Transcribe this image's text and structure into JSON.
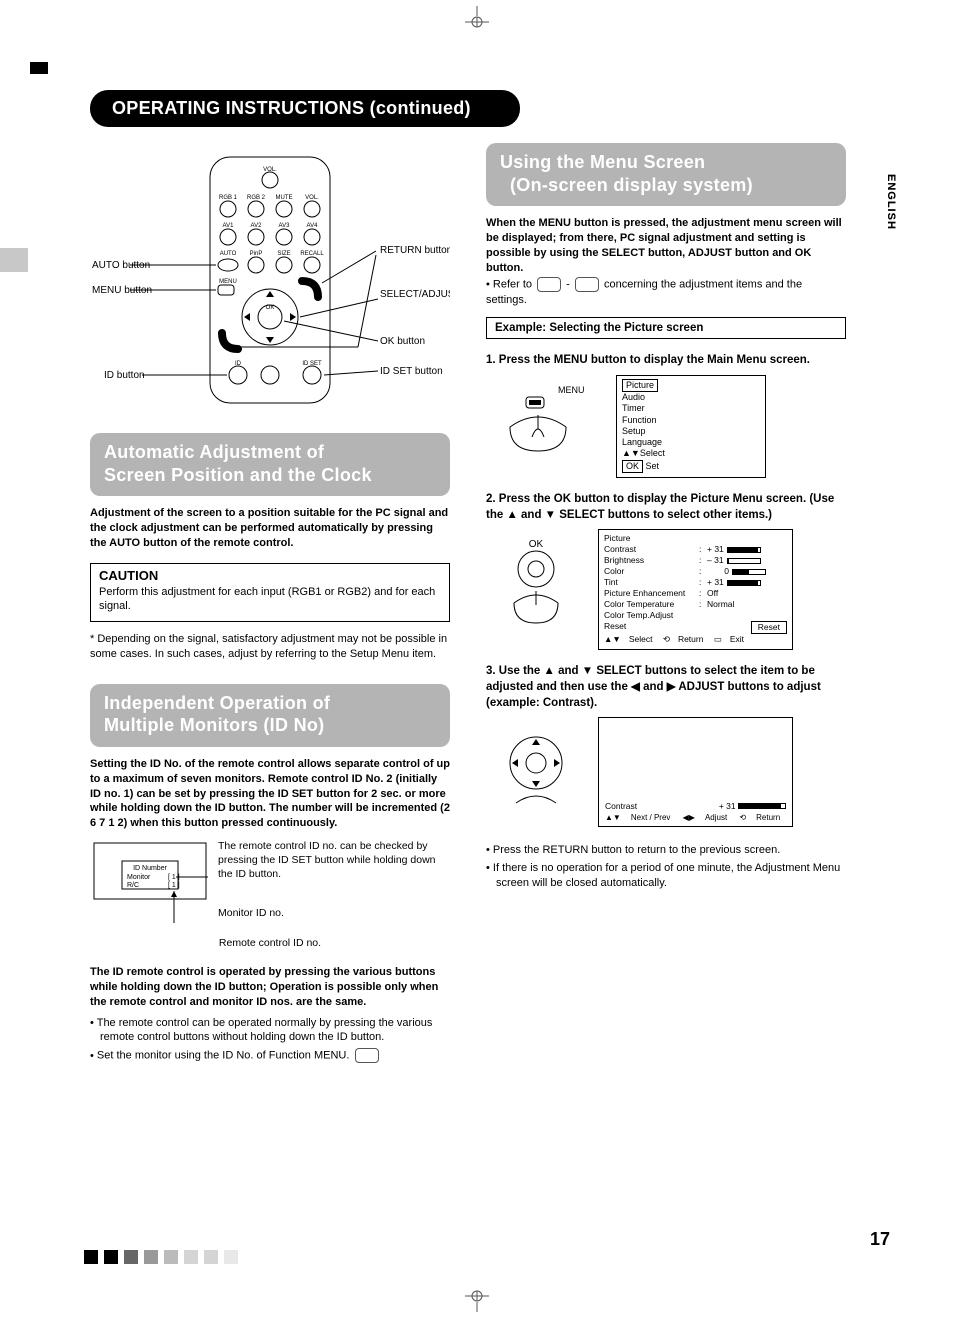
{
  "lang_tab": "ENGLISH",
  "page_number": "17",
  "header": "OPERATING INSTRUCTIONS (continued)",
  "remote_labels": {
    "auto": "AUTO button",
    "menu": "MENU button",
    "id": "ID button",
    "return": "RETURN buttons",
    "select_adjust": "SELECT/ADJUST buttons",
    "ok": "OK button",
    "idset": "ID SET button"
  },
  "remote_small": {
    "vol_minus": "VOL.",
    "rgb1": "RGB 1",
    "rgb2": "RGB 2",
    "mute": "MUTE",
    "vol": "VOL.",
    "av1": "AV1",
    "av2": "AV2",
    "av3": "AV3",
    "av4": "AV4",
    "auto": "AUTO",
    "pinp": "PinP",
    "size": "SIZE",
    "recall": "RECALL",
    "menu": "MENU",
    "ok": "OK",
    "id": "ID",
    "idset": "ID SET"
  },
  "sec1": {
    "title_l1": "Automatic Adjustment of",
    "title_l2": "Screen Position and the Clock",
    "body": "Adjustment of the screen to a position suitable for the PC signal and the clock adjustment can be performed automatically by pressing the AUTO button of the remote control.",
    "caution_h": "CAUTION",
    "caution_b": "Perform this adjustment for each input (RGB1 or RGB2) and for each signal.",
    "note": "* Depending on the signal, satisfactory adjustment may not be possible in some cases. In such cases, adjust by referring to the Setup Menu item."
  },
  "sec2": {
    "title_l1": "Independent Operation of",
    "title_l2": "Multiple Monitors (ID No)",
    "body": "Setting the ID No. of the remote control allows separate control of up to a maximum of seven monitors. Remote control ID No. 2 (initially ID no. 1) can be set by pressing the ID SET button for 2 sec. or more while holding down the ID button.  The number will be incremented (2   6   7   1   2) when this button pressed continuously.",
    "id_text": "The remote control ID no. can be checked by pressing the ID SET button while holding down the ID button.",
    "id_box_title": "ID Number",
    "id_box_monitor": "Monitor",
    "id_box_rc": "R/C",
    "id_box_val1": "[ 1 ]",
    "id_box_val2": "[ 1 ]",
    "monitor_id": "Monitor ID no.",
    "remote_id": "Remote control ID no.",
    "body2": "The ID remote control is operated by pressing the various buttons while holding down the ID button; Operation is possible only when the remote control and monitor ID nos. are the same.",
    "b1": "The remote control can be operated normally by pressing the various remote control buttons without holding down the ID button.",
    "b2": "Set the monitor using the ID No. of Function MENU."
  },
  "sec3": {
    "title_l1": "Using the Menu Screen",
    "title_l2": "(On-screen display system)",
    "intro": "When the MENU button is pressed, the adjustment menu screen will be displayed; from there, PC signal adjustment and setting is possible by using the SELECT button, ADJUST button and OK button.",
    "refer": "Refer to",
    "refer_tail": "concerning the adjustment items and the settings.",
    "example": "Example: Selecting the Picture screen",
    "step1": "1. Press the MENU button to display the Main Menu screen.",
    "menu_label": "MENU",
    "main_menu": {
      "items": [
        "Picture",
        "Audio",
        "Timer",
        "Function",
        "Setup",
        "Language"
      ],
      "hint_select": "Select",
      "hint_set": "Set",
      "ok": "OK"
    },
    "step2": "2. Press the OK button to display the Picture Menu screen. (Use the ▲ and ▼ SELECT buttons to select other items.)",
    "ok_label": "OK",
    "pic_menu": {
      "title": "Picture",
      "rows": [
        {
          "l": "Contrast",
          "v": "+ 31",
          "bar": 0.95
        },
        {
          "l": "Brightness",
          "v": "– 31",
          "bar": 0.05
        },
        {
          "l": "Color",
          "v": "0",
          "bar": 0.5
        },
        {
          "l": "Tint",
          "v": "+ 31",
          "bar": 0.95
        },
        {
          "l": "Picture Enhancement",
          "v": "Off"
        },
        {
          "l": "Color Temperature",
          "v": "Normal"
        },
        {
          "l": "Color Temp.Adjust",
          "v": ""
        },
        {
          "l": "Reset",
          "v": "",
          "btn": "Reset"
        }
      ],
      "hint_select": "Select",
      "hint_return": "Return",
      "hint_exit": "Exit"
    },
    "step3": "3. Use the ▲ and ▼ SELECT buttons to select the item to be adjusted and then use the ◀ and ▶ ADJUST buttons to adjust (example: Contrast).",
    "contrast_osd": {
      "l": "Contrast",
      "v": "+ 31",
      "hint_np": "Next / Prev",
      "hint_adjust": "Adjust",
      "hint_return": "Return"
    },
    "b1": "Press the RETURN button to return to the previous screen.",
    "b2": "If there is no operation for a period of one minute, the Adjustment Menu screen will be closed automatically."
  }
}
